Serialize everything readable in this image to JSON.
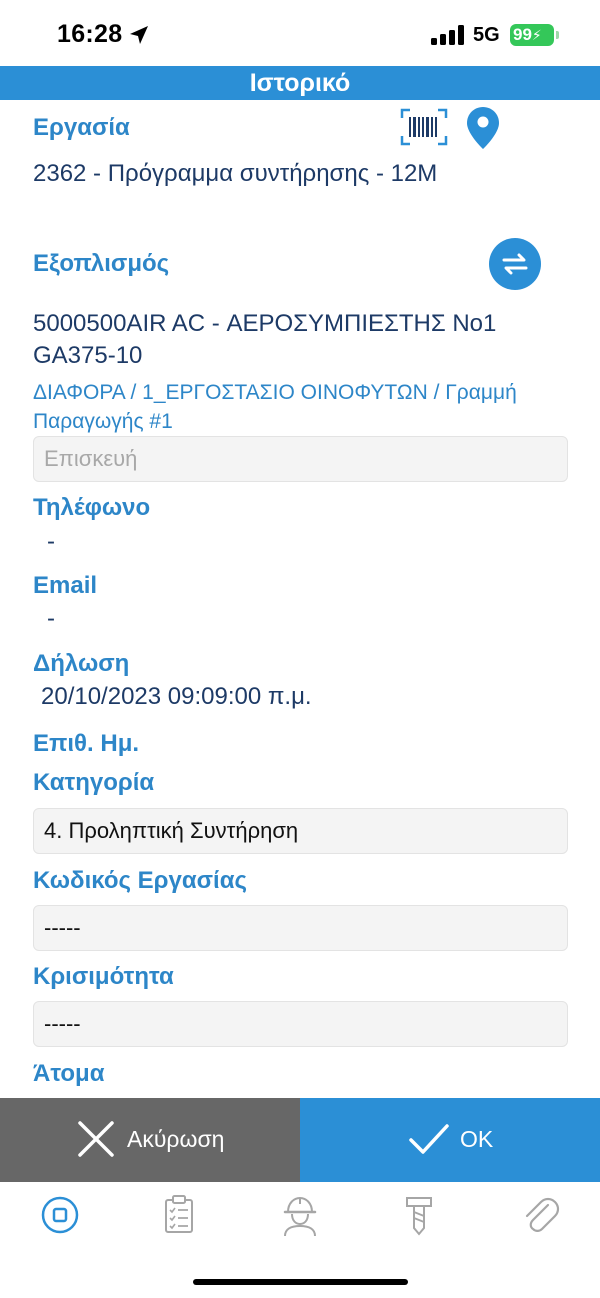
{
  "status_bar": {
    "time": "16:28",
    "network": "5G",
    "battery": "99"
  },
  "header": {
    "title": "Ιστορικό"
  },
  "task": {
    "label": "Εργασία",
    "value": "2362 - Πρόγραμμα συντήρησης - 12M"
  },
  "equipment": {
    "label": "Εξοπλισμός",
    "name_line1": "5000500AIR AC - ΑΕΡΟΣΥΜΠΙΕΣΤΗΣ No1",
    "name_line2": "GA375-10",
    "path": "ΔΙΑΦΟΡΑ / 1_ΕΡΓΟΣΤΑΣΙΟ ΟΙΝΟΦΥΤΩΝ / Γραμμή Παραγωγής #1",
    "repair_placeholder": "Επισκευή"
  },
  "phone": {
    "label": "Τηλέφωνο",
    "value": "-"
  },
  "email": {
    "label": "Email",
    "value": "-"
  },
  "declaration": {
    "label": "Δήλωση",
    "value": "20/10/2023 09:09:00 π.μ."
  },
  "desired_date": {
    "label": "Επιθ. Ημ."
  },
  "category": {
    "label": "Κατηγορία",
    "value": "4. Προληπτική Συντήρηση"
  },
  "task_code": {
    "label": "Κωδικός Εργασίας",
    "value": "-----"
  },
  "criticality": {
    "label": "Κρισιμότητα",
    "value": "-----"
  },
  "persons": {
    "label": "Άτομα"
  },
  "actions": {
    "cancel_label": "Ακύρωση",
    "ok_label": "OK"
  },
  "tabs": [
    "stop-icon",
    "checklist-icon",
    "technician-icon",
    "tool-icon",
    "attachment-icon"
  ],
  "colors": {
    "accent": "#2b8fd6",
    "label": "#2d86c8",
    "value": "#1d3a66",
    "cancel": "#676767"
  }
}
